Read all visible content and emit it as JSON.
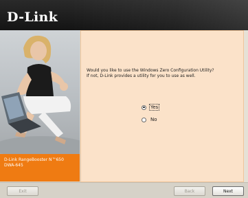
{
  "header": {
    "logo_text": "D-Link"
  },
  "sidebar": {
    "product_line1": "D-Link RangeBooster N™650",
    "product_line2": "DWA-645"
  },
  "main": {
    "question_line1": "Would you like to use the Windows Zero Configuration Utility?",
    "question_line2": "If not, D-Link provides a utility for you to use as well.",
    "options": [
      {
        "label": "Yes",
        "selected": true
      },
      {
        "label": "No",
        "selected": false
      }
    ]
  },
  "footer": {
    "exit_label": "Exit",
    "back_label": "Back",
    "next_label": "Next"
  },
  "colors": {
    "header_bg": "#1e1e1e",
    "accent_orange": "#ef7b12",
    "content_bg": "#fbe2c9"
  }
}
